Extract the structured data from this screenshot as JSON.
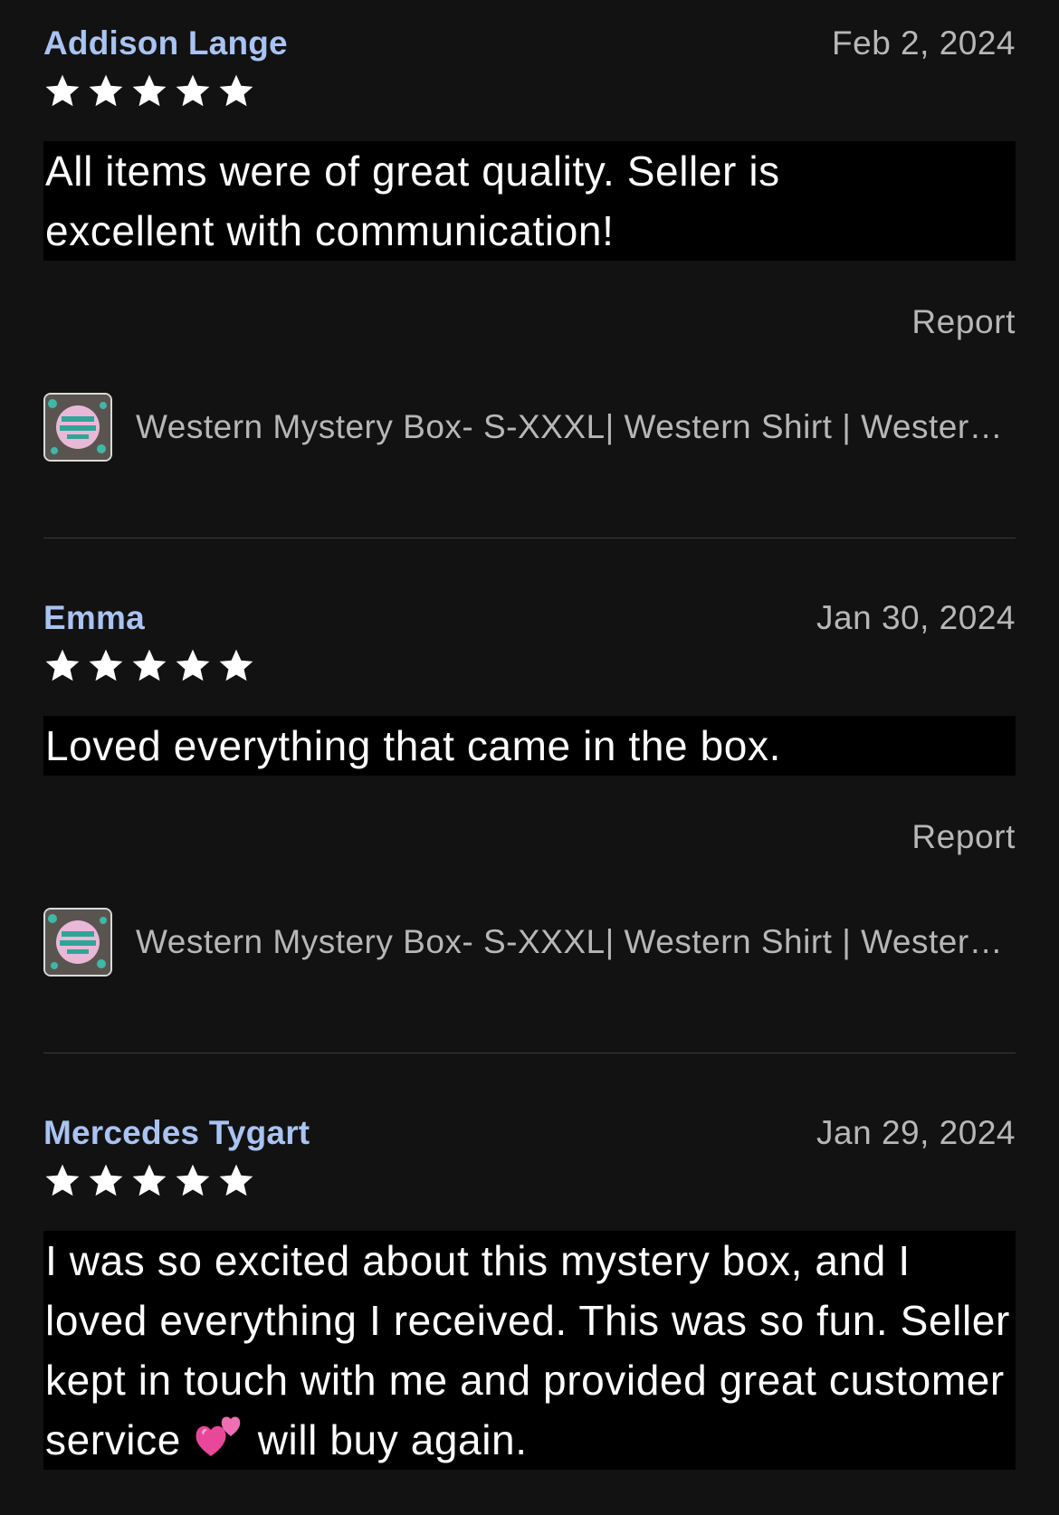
{
  "reviews": [
    {
      "name": "Addison Lange",
      "date": "Feb 2, 2024",
      "rating": 5,
      "text": "All items were of great quality. Seller is excellent with communication!",
      "report_label": "Report",
      "listing_title": "Western Mystery Box- S-XXXL| Western Shirt | Western Graphic Tee | Mystery Box",
      "listing_thumb_icon": "mystery-box-thumbnail"
    },
    {
      "name": "Emma",
      "date": "Jan 30, 2024",
      "rating": 5,
      "text": "Loved everything that came in the box.",
      "report_label": "Report",
      "listing_title": "Western Mystery Box- S-XXXL| Western Shirt | Western Graphic Tee | Mystery Box",
      "listing_thumb_icon": "mystery-box-thumbnail"
    },
    {
      "name": "Mercedes Tygart",
      "date": "Jan 29, 2024",
      "rating": 5,
      "text_before_emoji": "I was so excited about this mystery box, and I loved everything I received. This was so fun. Seller kept in touch with me and provided great customer service",
      "emoji": "two-hearts-emoji",
      "text_after_emoji": "will buy again."
    }
  ],
  "colors": {
    "background": "#121212",
    "reviewer_name": "#a9c3f2",
    "meta_text": "#b7b7b7",
    "body_text": "#ffffff",
    "star": "#ffffff",
    "divider": "#3a3a3a"
  }
}
